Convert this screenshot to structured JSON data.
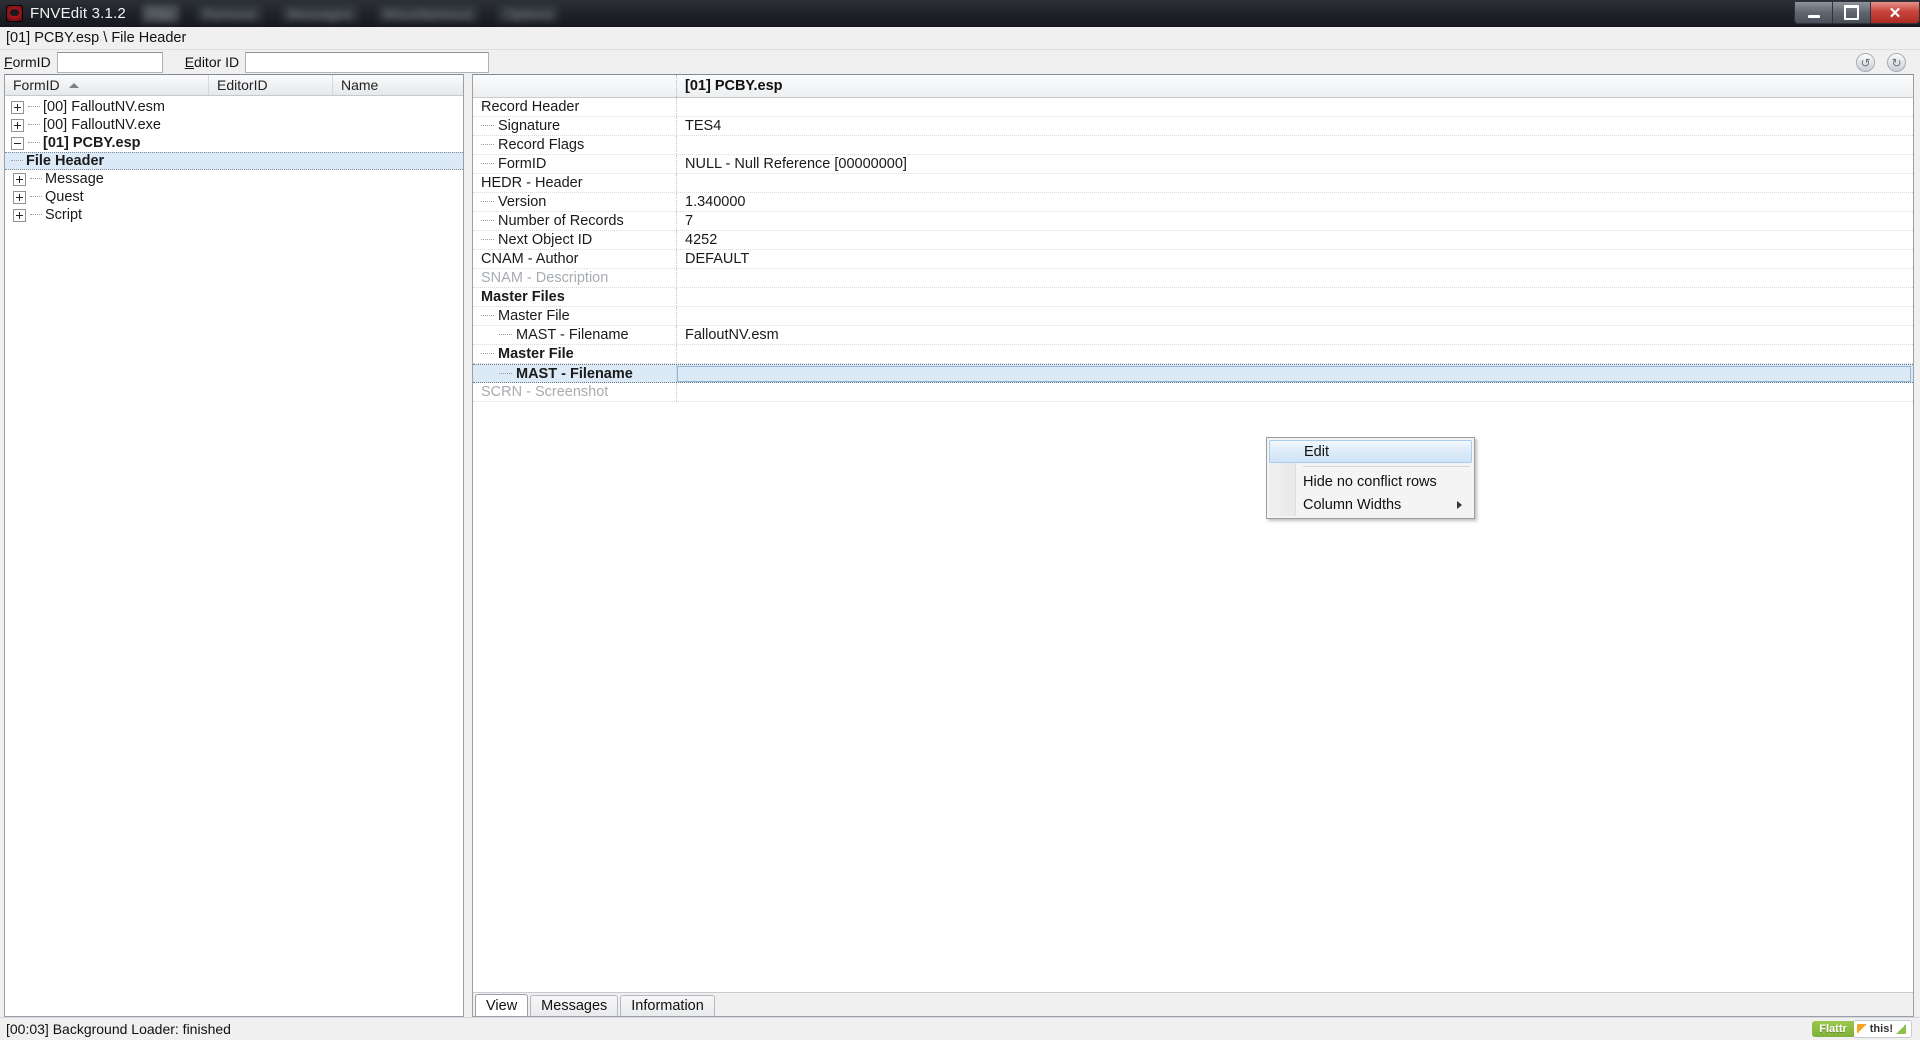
{
  "titlebar": {
    "app_title": "FNVEdit 3.1.2",
    "app_icon": "fnvedit-logo-icon",
    "menus": [
      "File",
      "Remove",
      "Messages",
      "Miscellaneous",
      "Options"
    ],
    "minimize_label": "Minimize",
    "maximize_label": "Restore",
    "close_label": "✕"
  },
  "pathbar": {
    "path": "[01] PCBY.esp \\ File Header"
  },
  "filterbar": {
    "formid_label": "FormID",
    "formid_value": "",
    "editorid_label": "Editor ID",
    "editorid_value": "",
    "back_icon": "↺",
    "forward_icon": "↻"
  },
  "tree": {
    "columns": [
      "FormID",
      "EditorID",
      "Name"
    ],
    "sort_column": "FormID",
    "sort_direction": "asc",
    "items": [
      {
        "label": "[00] FalloutNV.esm",
        "indent": 0,
        "expander": "plus",
        "bold": false,
        "selected": false
      },
      {
        "label": "[00] FalloutNV.exe",
        "indent": 0,
        "expander": "plus",
        "bold": false,
        "selected": false
      },
      {
        "label": "[01] PCBY.esp",
        "indent": 0,
        "expander": "minus",
        "bold": true,
        "selected": false
      },
      {
        "label": "File Header",
        "indent": 1,
        "expander": "none",
        "bold": true,
        "selected": true
      },
      {
        "label": "Message",
        "indent": 1,
        "expander": "plus",
        "bold": false,
        "selected": false
      },
      {
        "label": "Quest",
        "indent": 1,
        "expander": "plus",
        "bold": false,
        "selected": false
      },
      {
        "label": "Script",
        "indent": 1,
        "expander": "plus",
        "bold": false,
        "selected": false
      }
    ]
  },
  "record_view": {
    "column_header": "[01] PCBY.esp",
    "rows": [
      {
        "name": "Record Header",
        "value": "",
        "indent": 0,
        "bold": false,
        "dim": false,
        "leaf": false,
        "selected": false
      },
      {
        "name": "Signature",
        "value": "TES4",
        "indent": 1,
        "bold": false,
        "dim": false,
        "leaf": true,
        "selected": false
      },
      {
        "name": "Record Flags",
        "value": "",
        "indent": 1,
        "bold": false,
        "dim": false,
        "leaf": true,
        "selected": false
      },
      {
        "name": "FormID",
        "value": "NULL - Null Reference [00000000]",
        "indent": 1,
        "bold": false,
        "dim": false,
        "leaf": true,
        "selected": false
      },
      {
        "name": "HEDR - Header",
        "value": "",
        "indent": 0,
        "bold": false,
        "dim": false,
        "leaf": false,
        "selected": false
      },
      {
        "name": "Version",
        "value": "1.340000",
        "indent": 1,
        "bold": false,
        "dim": false,
        "leaf": true,
        "selected": false
      },
      {
        "name": "Number of Records",
        "value": "7",
        "indent": 1,
        "bold": false,
        "dim": false,
        "leaf": true,
        "selected": false
      },
      {
        "name": "Next Object ID",
        "value": "4252",
        "indent": 1,
        "bold": false,
        "dim": false,
        "leaf": true,
        "selected": false
      },
      {
        "name": "CNAM - Author",
        "value": "DEFAULT",
        "indent": 0,
        "bold": false,
        "dim": false,
        "leaf": false,
        "selected": false
      },
      {
        "name": "SNAM - Description",
        "value": "",
        "indent": 0,
        "bold": false,
        "dim": true,
        "leaf": false,
        "selected": false
      },
      {
        "name": "Master Files",
        "value": "",
        "indent": 0,
        "bold": true,
        "dim": false,
        "leaf": false,
        "selected": false
      },
      {
        "name": "Master File",
        "value": "",
        "indent": 1,
        "bold": false,
        "dim": false,
        "leaf": true,
        "selected": false
      },
      {
        "name": "MAST - Filename",
        "value": "FalloutNV.esm",
        "indent": 2,
        "bold": false,
        "dim": false,
        "leaf": true,
        "selected": false
      },
      {
        "name": "Master File",
        "value": "",
        "indent": 1,
        "bold": true,
        "dim": false,
        "leaf": true,
        "selected": false
      },
      {
        "name": "MAST - Filename",
        "value": "",
        "indent": 2,
        "bold": true,
        "dim": false,
        "leaf": true,
        "selected": true
      },
      {
        "name": "SCRN - Screenshot",
        "value": "",
        "indent": 0,
        "bold": false,
        "dim": true,
        "leaf": false,
        "selected": false
      }
    ]
  },
  "context_menu": {
    "items": [
      {
        "label": "Edit",
        "highlighted": true,
        "separator_after": true,
        "submenu": false
      },
      {
        "label": "Hide no conflict rows",
        "highlighted": false,
        "separator_after": false,
        "submenu": false
      },
      {
        "label": "Column Widths",
        "highlighted": false,
        "separator_after": false,
        "submenu": true
      }
    ]
  },
  "bottom_tabs": {
    "tabs": [
      {
        "label": "View",
        "active": true
      },
      {
        "label": "Messages",
        "active": false
      },
      {
        "label": "Information",
        "active": false
      }
    ]
  },
  "statusbar": {
    "message": "[00:03] Background Loader: finished",
    "flattr_left": "Flattr",
    "flattr_right": "this!"
  },
  "colors": {
    "selection_blue": "#dceaf7",
    "titlebar_dark": "#20242a",
    "close_red": "#c9453c",
    "flattr_green": "#7fb038"
  }
}
